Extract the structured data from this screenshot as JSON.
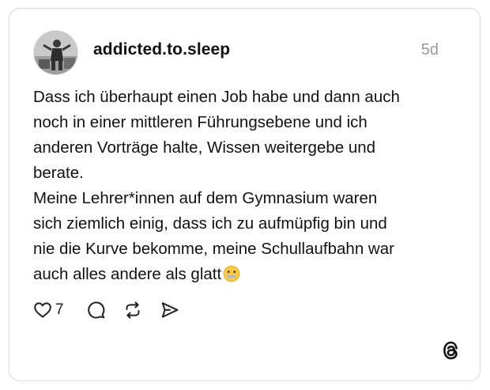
{
  "post": {
    "username": "addicted.to.sleep",
    "timestamp": "5d",
    "text_lines": [
      "Dass ich überhaupt einen Job habe und dann auch",
      "noch in einer mittleren Führungsebene und ich",
      "anderen Vorträge halte, Wissen weitergebe und",
      "berate.",
      "Meine Lehrer*innen auf dem Gymnasium waren",
      "sich ziemlich einig, dass ich zu aufmüpfig bin und",
      "nie die Kurve bekomme, meine Schullaufbahn war",
      "auch alles andere als glatt"
    ],
    "emoji": "zipper-mouth-face-emoji"
  },
  "actions": {
    "like_count": "7",
    "icons": [
      "heart-icon",
      "comment-icon",
      "repost-icon",
      "share-icon"
    ]
  },
  "branding": {
    "logo": "threads-logo-icon"
  },
  "colors": {
    "text": "#111111",
    "muted": "#9a9a9a",
    "border": "#d9d9d9",
    "emoji": "#f7c948"
  }
}
